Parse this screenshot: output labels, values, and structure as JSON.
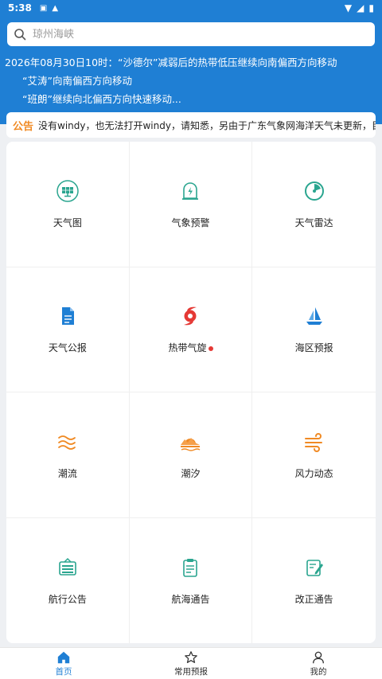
{
  "status": {
    "time": "5:38"
  },
  "search": {
    "placeholder": "琼州海峡"
  },
  "news": [
    "2026年08月30日10时：“沙德尔”减弱后的热带低压继续向南偏西方向移动",
    "“艾涛”向南偏西方向移动",
    "“班朗”继续向北偏西方向快速移动..."
  ],
  "notice": {
    "tag": "公告",
    "text": "没有windy，也无法打开windy，请知悉，另由于广东气象网海洋天气未更新，目前广"
  },
  "grid": [
    {
      "label": "天气图",
      "icon": "solar-panel-icon",
      "color": "#2aa58f"
    },
    {
      "label": "气象预警",
      "icon": "warning-light-icon",
      "color": "#2aa58f"
    },
    {
      "label": "天气雷达",
      "icon": "radar-icon",
      "color": "#2aa58f"
    },
    {
      "label": "天气公报",
      "icon": "document-icon",
      "color": "#1f7fd4"
    },
    {
      "label": "热带气旋",
      "icon": "typhoon-icon",
      "color": "#e53935",
      "badge": true
    },
    {
      "label": "海区预报",
      "icon": "sailboat-icon",
      "color": "#1f7fd4"
    },
    {
      "label": "潮流",
      "icon": "waves-icon",
      "color": "#f08a24"
    },
    {
      "label": "潮汐",
      "icon": "sunset-icon",
      "color": "#f08a24"
    },
    {
      "label": "风力动态",
      "icon": "wind-icon",
      "color": "#f08a24"
    },
    {
      "label": "航行公告",
      "icon": "notice-board-icon",
      "color": "#2aa58f"
    },
    {
      "label": "航海通告",
      "icon": "clipboard-icon",
      "color": "#2aa58f"
    },
    {
      "label": "改正通告",
      "icon": "edit-note-icon",
      "color": "#2aa58f"
    }
  ],
  "tabs": [
    {
      "label": "首页",
      "icon": "home-icon",
      "active": true
    },
    {
      "label": "常用预报",
      "icon": "star-icon",
      "active": false
    },
    {
      "label": "我的",
      "icon": "user-icon",
      "active": false
    }
  ],
  "colors": {
    "primary": "#1f7fd4",
    "teal": "#2aa58f",
    "orange": "#f08a24",
    "red": "#e53935"
  }
}
